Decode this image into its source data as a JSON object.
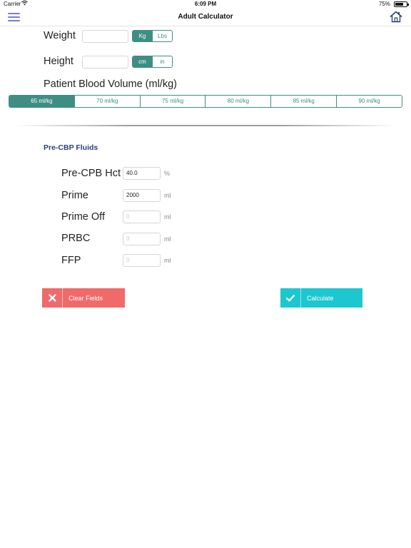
{
  "status": {
    "carrier": "Carrier",
    "time": "6:09 PM",
    "battery_pct": "75%",
    "battery_level": 0.75
  },
  "nav": {
    "title": "Adult Calculator"
  },
  "weight": {
    "label": "Weight",
    "value": "",
    "units": [
      "Kg",
      "Lbs"
    ],
    "selected_unit": "Kg"
  },
  "height": {
    "label": "Height",
    "value": "",
    "units": [
      "cm",
      "in"
    ],
    "selected_unit": "cm"
  },
  "blood_volume": {
    "label": "Patient Blood Volume (ml/kg)",
    "options": [
      "65 ml/kg",
      "70 ml/kg",
      "75 ml/kg",
      "80 ml/kg",
      "85 ml/kg",
      "90 ml/kg"
    ],
    "selected": "65 ml/kg"
  },
  "fluids": {
    "section_title": "Pre-CBP Fluids",
    "rows": [
      {
        "label": "Pre-CPB Hct",
        "value": "40.0",
        "placeholder": "",
        "unit": "%"
      },
      {
        "label": "Prime",
        "value": "2000",
        "placeholder": "",
        "unit": "ml"
      },
      {
        "label": "Prime Off",
        "value": "",
        "placeholder": "0",
        "unit": "ml"
      },
      {
        "label": "PRBC",
        "value": "",
        "placeholder": "0",
        "unit": "ml"
      },
      {
        "label": "FFP",
        "value": "",
        "placeholder": "0",
        "unit": "ml"
      }
    ]
  },
  "buttons": {
    "clear_label": "Clear Fields",
    "calculate_label": "Calculate"
  },
  "colors": {
    "accent_teal": "#3f8e84",
    "clear_red": "#f06a6a",
    "calculate_cyan": "#1dc7cf",
    "menu_purple": "#7a7ec8",
    "section_navy": "#2b3f78"
  }
}
